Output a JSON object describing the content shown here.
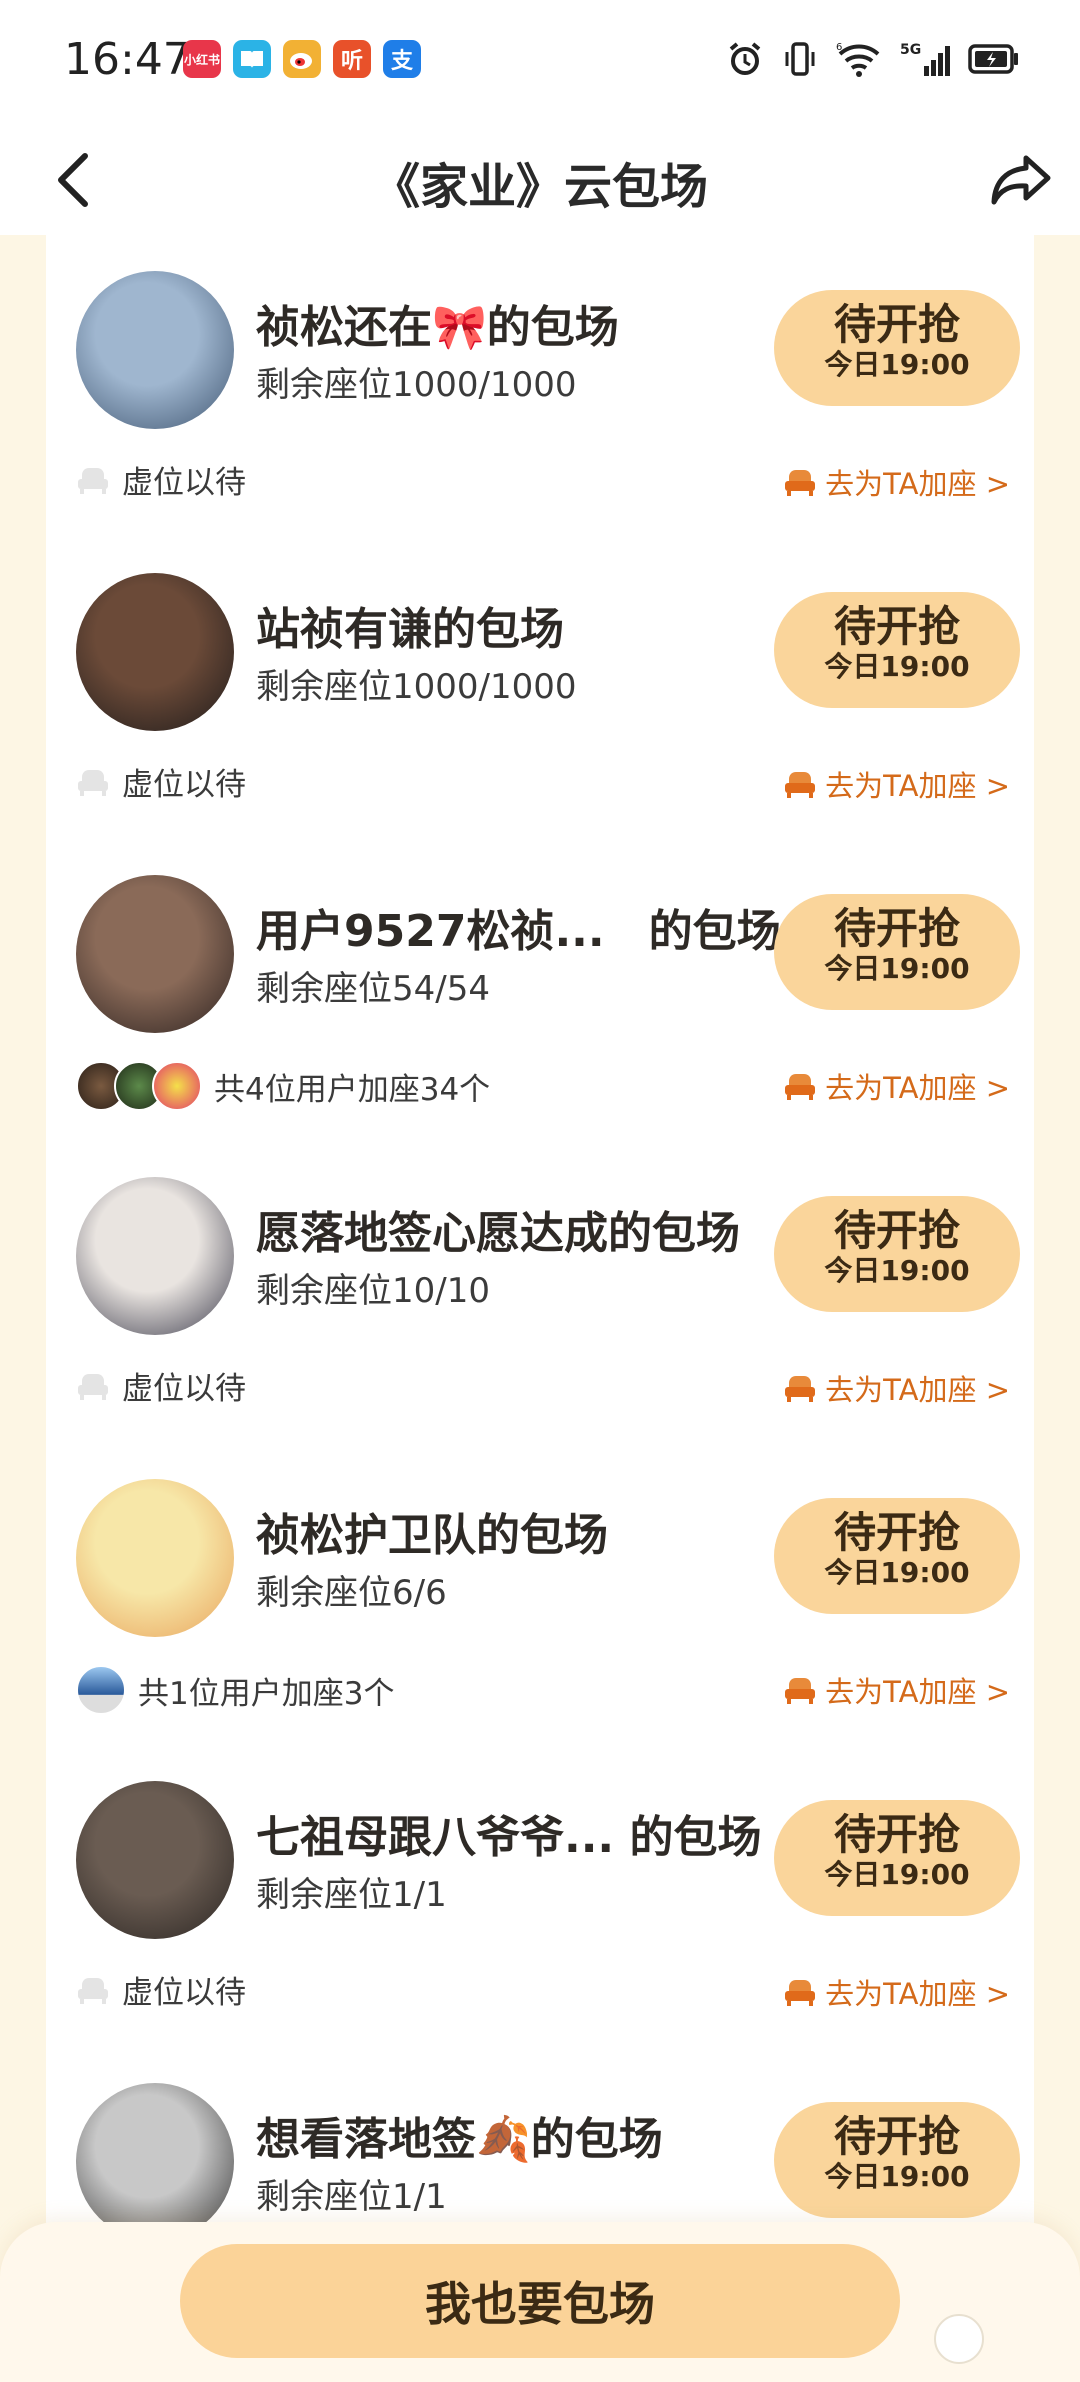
{
  "status_bar": {
    "time": "16:47",
    "apps": [
      {
        "label": "小红书",
        "color": "#e8364a"
      },
      {
        "label": "书",
        "color": "#2bb3e6"
      },
      {
        "label": "微",
        "color": "#f2b134"
      },
      {
        "label": "听",
        "color": "#e8512a"
      },
      {
        "label": "支",
        "color": "#1f7ee8"
      }
    ],
    "signal_label": "5G"
  },
  "header": {
    "title": "《家业》云包场"
  },
  "rooms": [
    {
      "title": "祯松还在🎀的包场",
      "seats": "剩余座位1000/1000",
      "button_main": "待开抢",
      "button_sub": "今日19:00",
      "footer_text": "虚位以待",
      "footer_type": "empty",
      "add_seat": "去为TA加座 >",
      "avatar_colors": [
        "#9fb6cf",
        "#3f5570"
      ]
    },
    {
      "title": "站祯有谦的包场",
      "seats": "剩余座位1000/1000",
      "button_main": "待开抢",
      "button_sub": "今日19:00",
      "footer_text": "虚位以待",
      "footer_type": "empty",
      "add_seat": "去为TA加座 >",
      "avatar_colors": [
        "#6b4a38",
        "#1d1a1a"
      ]
    },
    {
      "title": "用户9527松祯...　的包场",
      "seats": "剩余座位54/54",
      "button_main": "待开抢",
      "button_sub": "今日19:00",
      "footer_text": "共4位用户加座34个",
      "footer_type": "users",
      "add_seat": "去为TA加座 >",
      "avatar_colors": [
        "#8a6a58",
        "#2c2220"
      ]
    },
    {
      "title": "愿落地签心愿达成的包场",
      "seats": "剩余座位10/10",
      "button_main": "待开抢",
      "button_sub": "今日19:00",
      "footer_text": "虚位以待",
      "footer_type": "empty",
      "add_seat": "去为TA加座 >",
      "avatar_colors": [
        "#e9e4e0",
        "#3a3a4a"
      ]
    },
    {
      "title": "祯松护卫队的包场",
      "seats": "剩余座位6/6",
      "button_main": "待开抢",
      "button_sub": "今日19:00",
      "footer_text": "共1位用户加座3个",
      "footer_type": "users1",
      "add_seat": "去为TA加座 >",
      "avatar_colors": [
        "#f7e7a8",
        "#e8a25a"
      ]
    },
    {
      "title": "七祖母跟八爷爷... 的包场",
      "seats": "剩余座位1/1",
      "button_main": "待开抢",
      "button_sub": "今日19:00",
      "footer_text": "虚位以待",
      "footer_type": "empty",
      "add_seat": "去为TA加座 >",
      "avatar_colors": [
        "#6a5c52",
        "#2a2522"
      ]
    },
    {
      "title": "想看落地签🍂的包场",
      "seats": "剩余座位1/1",
      "button_main": "待开抢",
      "button_sub": "今日19:00",
      "footer_text": "",
      "footer_type": "none",
      "add_seat": "",
      "avatar_colors": [
        "#c8c8c8",
        "#303030"
      ]
    }
  ],
  "bottom": {
    "button_label": "我也要包场"
  }
}
